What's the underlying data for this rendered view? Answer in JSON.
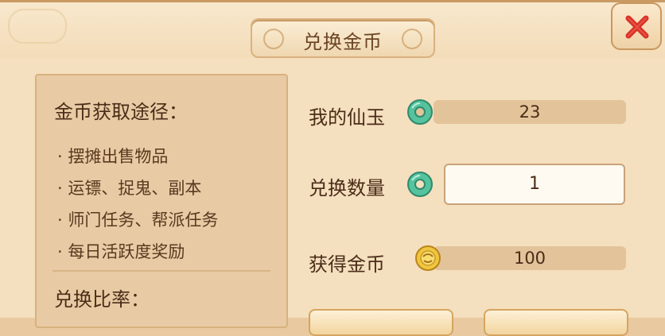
{
  "dialog": {
    "title": "兑换金币",
    "close_label": "X"
  },
  "left_panel": {
    "ways_title": "金币获取途径：",
    "ways": [
      "摆摊出售物品",
      "运镖、捉鬼、副本",
      "师门任务、帮派任务",
      "每日活跃度奖励"
    ],
    "rate_title": "兑换比率："
  },
  "fields": {
    "my_jade_label": "我的仙玉",
    "my_jade_value": "23",
    "exchange_qty_label": "兑换数量",
    "exchange_qty_value": "1",
    "gain_gold_label": "获得金币",
    "gain_gold_value": "100"
  },
  "icons": {
    "jade": "jade-coin-icon",
    "gold": "gold-coin-icon",
    "close": "close-x-icon"
  },
  "colors": {
    "accent_red": "#d8322a",
    "jade_green": "#3fae8d",
    "gold": "#e8b430"
  }
}
